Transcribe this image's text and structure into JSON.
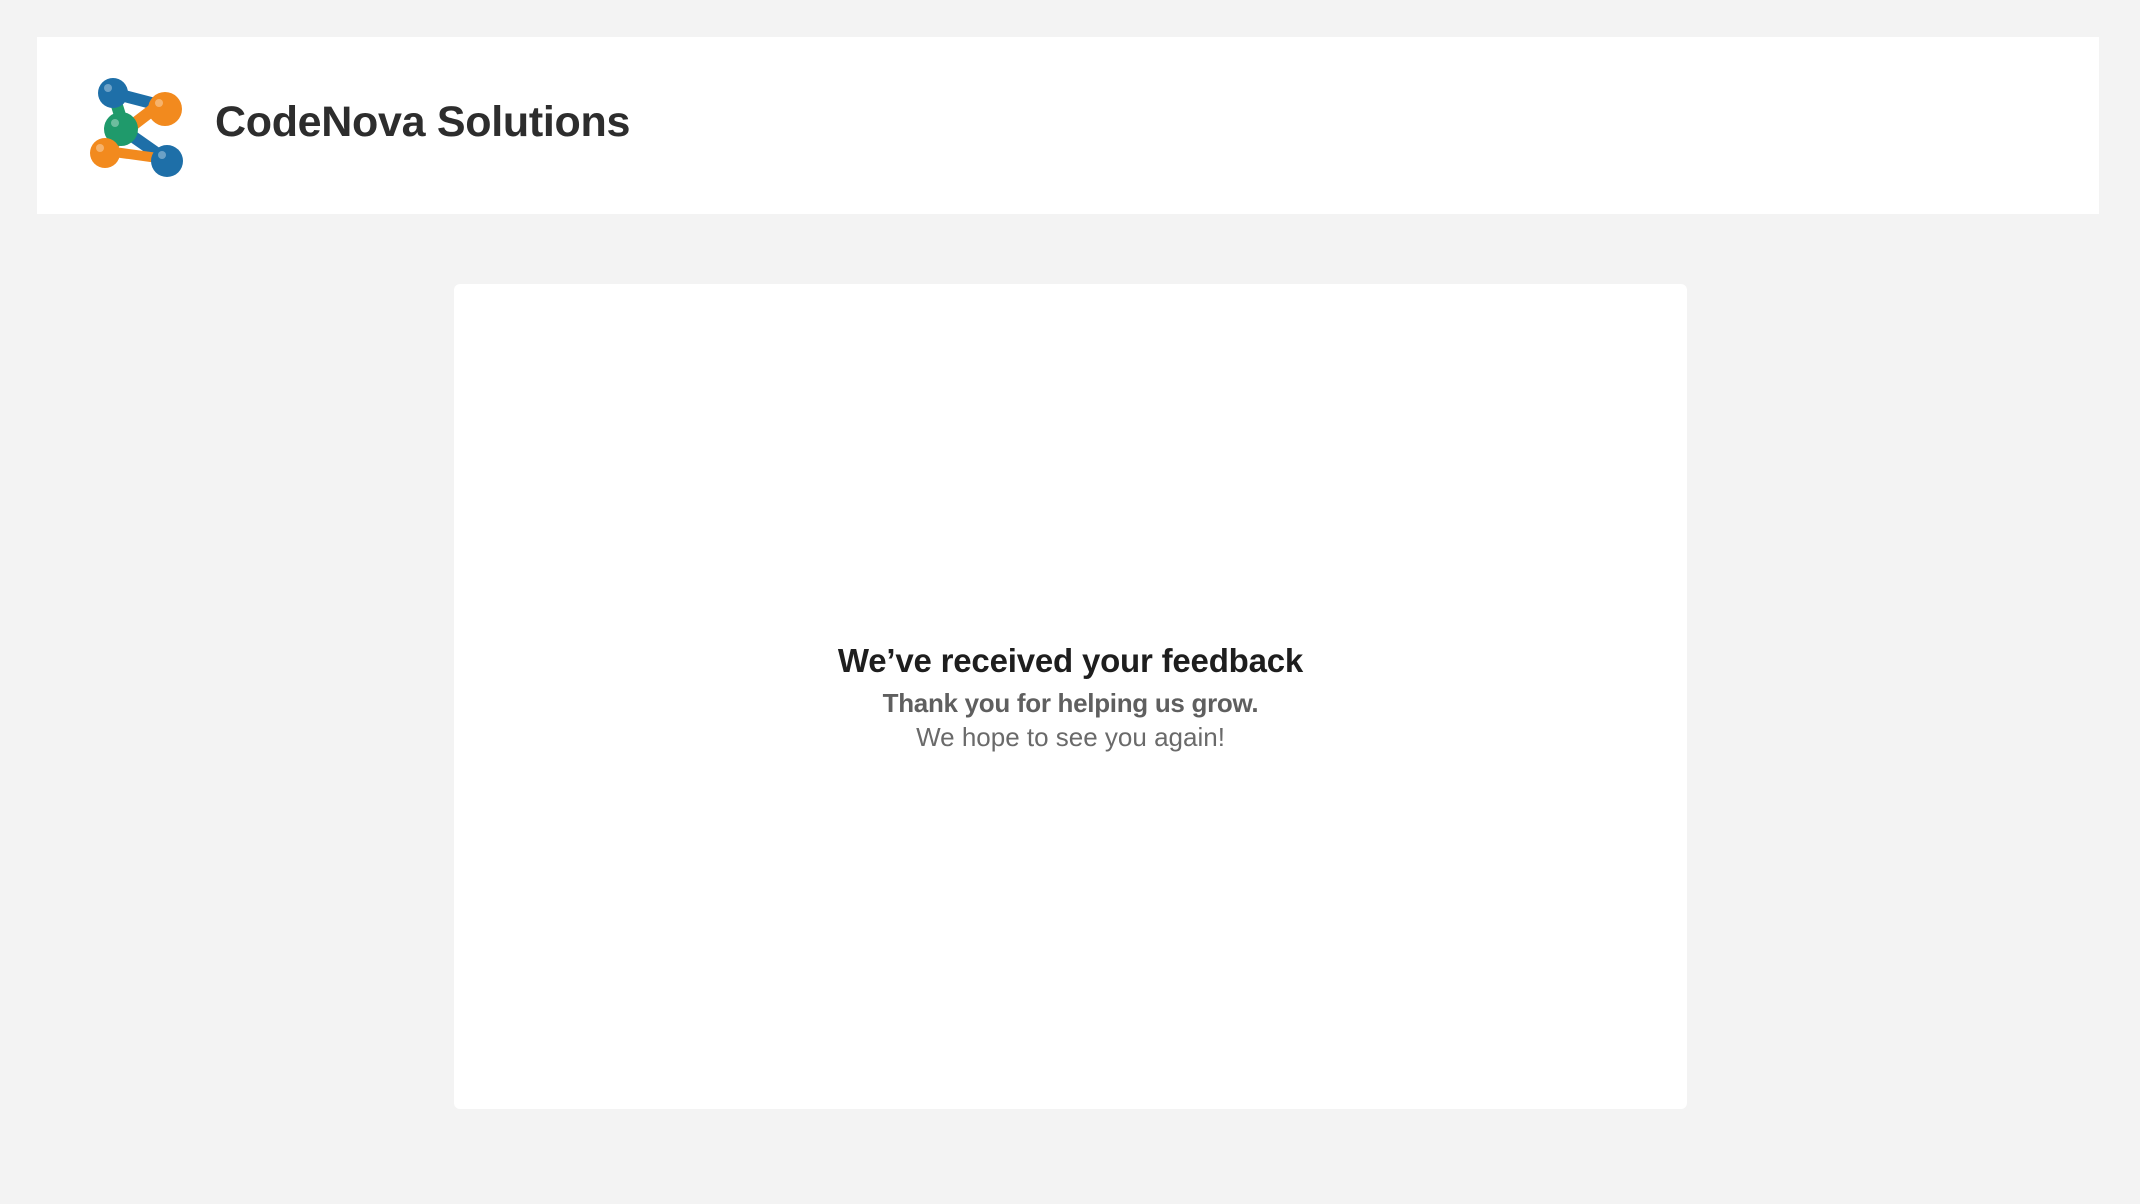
{
  "header": {
    "logo_icon": "molecule-logo-icon",
    "brand_name": "CodeNova Solutions"
  },
  "card": {
    "title": "We’ve received your feedback",
    "subtitle": "Thank you for helping us grow.",
    "note": "We hope to see you again!"
  },
  "colors": {
    "page_background": "#f3f3f3",
    "panel_background": "#ffffff",
    "logo_blue": "#1e6fa8",
    "logo_orange": "#f28a1e",
    "logo_green": "#1f9a6b"
  }
}
